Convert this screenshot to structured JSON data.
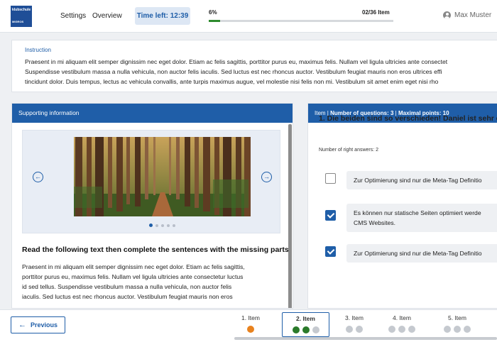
{
  "header": {
    "logo_line1": "klubschule",
    "logo_line2": "MIGROS",
    "nav": [
      "Settings",
      "Overview"
    ],
    "timer": "Time left: 12:39",
    "progress_percent": "6%",
    "progress_fraction": 0.06,
    "progress_count": "02/36 Item",
    "user_name": "Max Muster"
  },
  "instruction": {
    "title": "Instruction",
    "lines": [
      "Praesent in mi aliquam elit semper dignissim nec eget dolor. Etiam ac felis sagittis, porttitor purus eu, maximus felis. Nullam vel ligula ultricies ante consectet",
      "Suspendisse vestibulum massa a nulla vehicula, non auctor felis iaculis. Sed luctus est nec rhoncus auctor. Vestibulum feugiat mauris non eros ultrices effi",
      "tincidunt dolor. Duis tempus, lectus ac vehicula convallis, ante turpis maximus augue, vel molestie nisi felis non mi. Vestibulum sit amet enim eget nisi rho"
    ]
  },
  "supporting": {
    "title": "Supporting information",
    "reading_title": "Read the following text then complete the sentences with the missing parts",
    "reading_lines": [
      "Praesent in mi aliquam elit semper dignissim nec eget dolor. Etiam ac felis sagittis,",
      "porttitor purus eu, maximus felis. Nullam vel ligula ultricies ante consectetur luctus",
      "id sed tellus. Suspendisse vestibulum massa a nulla vehicula, non auctor felis",
      "iaculis. Sed luctus est nec rhoncus auctor. Vestibulum feugiat mauris non eros"
    ]
  },
  "question": {
    "header_item": "Item",
    "header_questions": "Number of questions: 3",
    "header_points": "Maximal points: 10",
    "title": "1. Die beiden sind so verschieden! Daniel ist sehr di",
    "right_answers": "Number of right answers: 2",
    "options": [
      {
        "lines": [
          "Zur Optimierung sind nur die Meta-Tag Definitio"
        ],
        "checked": false
      },
      {
        "lines": [
          "Es können nur statische Seiten optimiert werde",
          "CMS Websites."
        ],
        "checked": true
      },
      {
        "lines": [
          "Zur Optimierung sind nur die Meta-Tag Definitio"
        ],
        "checked": true
      }
    ]
  },
  "footer": {
    "previous": "Previous",
    "items": [
      {
        "label": "1. Item",
        "dots": [
          "orange"
        ]
      },
      {
        "label": "2. Item",
        "dots": [
          "green",
          "green",
          "grey"
        ]
      },
      {
        "label": "3. Item",
        "dots": [
          "grey",
          "grey"
        ]
      },
      {
        "label": "4. Item",
        "dots": [
          "grey",
          "grey",
          "grey"
        ]
      },
      {
        "label": "5. Item",
        "dots": [
          "grey",
          "grey",
          "grey"
        ]
      }
    ]
  }
}
